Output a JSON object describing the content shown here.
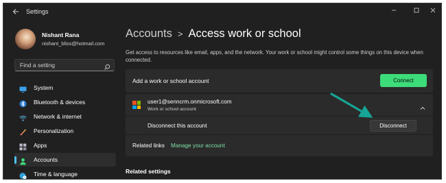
{
  "window": {
    "app_title": "Settings"
  },
  "user": {
    "name": "Nishant Rana",
    "email": "nishant_bliss@hotmail.com"
  },
  "search": {
    "placeholder": "Find a setting"
  },
  "sidebar": {
    "items": [
      {
        "label": "System",
        "icon": "monitor-icon",
        "active": false
      },
      {
        "label": "Bluetooth & devices",
        "icon": "bluetooth-icon",
        "active": false
      },
      {
        "label": "Network & internet",
        "icon": "wifi-icon",
        "active": false
      },
      {
        "label": "Personalization",
        "icon": "brush-icon",
        "active": false
      },
      {
        "label": "Apps",
        "icon": "apps-icon",
        "active": false
      },
      {
        "label": "Accounts",
        "icon": "person-icon",
        "active": true
      },
      {
        "label": "Time & language",
        "icon": "globe-clock-icon",
        "active": false
      }
    ]
  },
  "breadcrumb": {
    "parent": "Accounts",
    "separator": ">",
    "current": "Access work or school"
  },
  "main": {
    "description": "Get access to resources like email, apps, and the network. Your work or school might control some things on this device when connected.",
    "add_account_label": "Add a work or school account",
    "connect_label": "Connect",
    "account": {
      "email": "user1@senncrm.onmicrosoft.com",
      "type": "Work or school account",
      "disconnect_label": "Disconnect this account",
      "disconnect_button": "Disconnect",
      "related_links_label": "Related links",
      "manage_link": "Manage your account"
    },
    "related_settings": "Related settings"
  },
  "colors": {
    "window_bg": "#202020",
    "card_bg": "#2b2b2b",
    "accent_green": "#3ddc7a",
    "link_green": "#7ee2a8",
    "active_indicator": "#4cc2ff",
    "annotation_arrow": "#16a596"
  }
}
